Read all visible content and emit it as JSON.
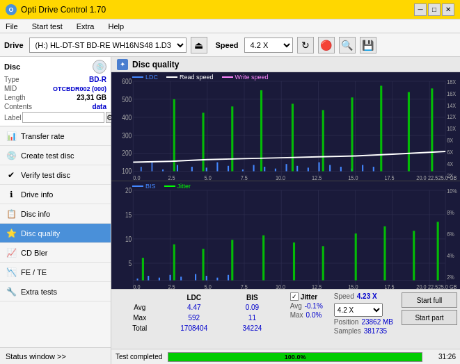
{
  "titleBar": {
    "title": "Opti Drive Control 1.70",
    "minBtn": "─",
    "maxBtn": "□",
    "closeBtn": "✕"
  },
  "menuBar": {
    "items": [
      "File",
      "Start test",
      "Extra",
      "Help"
    ]
  },
  "toolbar": {
    "driveLabel": "Drive",
    "driveValue": "(H:)  HL-DT-ST BD-RE  WH16NS48 1.D3",
    "speedLabel": "Speed",
    "speedValue": "4.2 X"
  },
  "discPanel": {
    "label": "Disc",
    "typeLabel": "Type",
    "typeValue": "BD-R",
    "midLabel": "MID",
    "midValue": "OTCBDR002 (000)",
    "lengthLabel": "Length",
    "lengthValue": "23,31 GB",
    "contentsLabel": "Contents",
    "contentsValue": "data",
    "labelLabel": "Label",
    "labelValue": ""
  },
  "navItems": [
    {
      "id": "transfer-rate",
      "label": "Transfer rate",
      "icon": "📊"
    },
    {
      "id": "create-test-disc",
      "label": "Create test disc",
      "icon": "💿"
    },
    {
      "id": "verify-test-disc",
      "label": "Verify test disc",
      "icon": "✔"
    },
    {
      "id": "drive-info",
      "label": "Drive info",
      "icon": "ℹ"
    },
    {
      "id": "disc-info",
      "label": "Disc info",
      "icon": "📋"
    },
    {
      "id": "disc-quality",
      "label": "Disc quality",
      "icon": "⭐",
      "active": true
    },
    {
      "id": "cd-bler",
      "label": "CD Bler",
      "icon": "📈"
    },
    {
      "id": "fe-te",
      "label": "FE / TE",
      "icon": "📉"
    },
    {
      "id": "extra-tests",
      "label": "Extra tests",
      "icon": "🔧"
    }
  ],
  "statusWindow": {
    "label": "Status window >>"
  },
  "discQuality": {
    "title": "Disc quality"
  },
  "chartTop": {
    "legend": [
      {
        "label": "LDC",
        "color": "#4488ff"
      },
      {
        "label": "Read speed",
        "color": "#ffffff"
      },
      {
        "label": "Write speed",
        "color": "#ff88ff"
      }
    ],
    "yMax": 600,
    "yLabels": [
      "600",
      "500",
      "400",
      "300",
      "200",
      "100"
    ],
    "rightLabels": [
      "18X",
      "16X",
      "14X",
      "12X",
      "10X",
      "8X",
      "6X",
      "4X",
      "2X"
    ],
    "xLabels": [
      "0.0",
      "2.5",
      "5.0",
      "7.5",
      "10.0",
      "12.5",
      "15.0",
      "17.5",
      "20.0",
      "22.5",
      "25.0 GB"
    ]
  },
  "chartBottom": {
    "legend": [
      {
        "label": "BIS",
        "color": "#4488ff"
      },
      {
        "label": "Jitter",
        "color": "#00ff00"
      }
    ],
    "yMax": 20,
    "yLabels": [
      "20",
      "15",
      "10",
      "5"
    ],
    "rightLabels": [
      "10%",
      "8%",
      "6%",
      "4%",
      "2%"
    ],
    "xLabels": [
      "0.0",
      "2.5",
      "5.0",
      "7.5",
      "10.0",
      "12.5",
      "15.0",
      "17.5",
      "20.0",
      "22.5",
      "25.0 GB"
    ]
  },
  "stats": {
    "headers": [
      "",
      "LDC",
      "BIS",
      "",
      "Jitter",
      "Speed",
      ""
    ],
    "avgLabel": "Avg",
    "avgLdc": "4.47",
    "avgBis": "0.09",
    "avgJitter": "-0.1%",
    "avgJitterColor": "blue",
    "maxLabel": "Max",
    "maxLdc": "592",
    "maxBis": "11",
    "maxJitter": "0.0%",
    "totalLabel": "Total",
    "totalLdc": "1708404",
    "totalBis": "34224",
    "jitterLabel": "Jitter",
    "jitterChecked": true,
    "speedLabel": "Speed",
    "speedValue": "4.23 X",
    "speedSelect": "4.2 X",
    "posLabel": "Position",
    "posValue": "23862 MB",
    "samplesLabel": "Samples",
    "samplesValue": "381735",
    "startFullBtn": "Start full",
    "startPartBtn": "Start part"
  },
  "progress": {
    "percent": 100.0,
    "percentLabel": "100.0%",
    "statusLabel": "Test completed",
    "time": "31:26"
  }
}
